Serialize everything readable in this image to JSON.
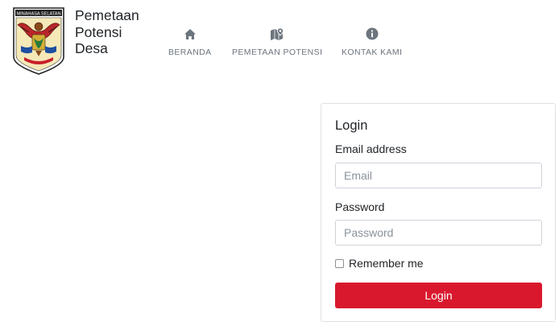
{
  "brand": {
    "logo_text": "MINAHASA SELATAN",
    "title_lines": [
      "Pemetaan",
      "Potensi",
      "Desa"
    ]
  },
  "nav": [
    {
      "label": "BERANDA",
      "icon": "home-icon"
    },
    {
      "label": "PEMETAAN POTENSI",
      "icon": "map-marker-icon"
    },
    {
      "label": "KONTAK KAMI",
      "icon": "info-icon"
    }
  ],
  "login": {
    "title": "Login",
    "email_label": "Email address",
    "email_placeholder": "Email",
    "password_label": "Password",
    "password_placeholder": "Password",
    "remember_label": "Remember me",
    "remember_checked": false,
    "button_label": "Login"
  },
  "colors": {
    "primary_button": "#d9182e",
    "nav_icon": "#6c757d"
  }
}
